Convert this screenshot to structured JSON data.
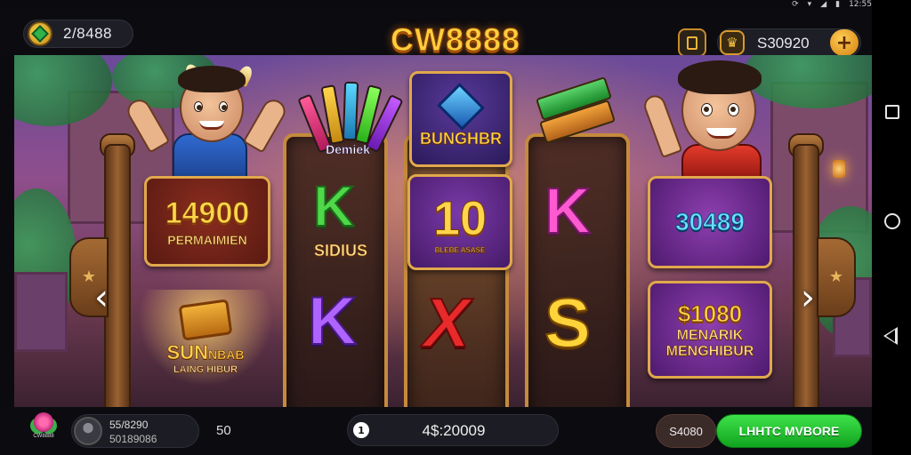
{
  "status_bar": {
    "time": "12:55"
  },
  "header": {
    "game_title": "CW8888",
    "left_balance": "2/8488",
    "right_balance": "S30920",
    "plus_label": "+"
  },
  "reels": {
    "left": {
      "tile_top_number": "14900",
      "tile_top_caption": "PERMAIMIEN",
      "tile_bottom_line1": "SUN",
      "tile_bottom_line2": "NBAB",
      "tile_bottom_caption": "LAING HIBUR"
    },
    "reel1": {
      "top_label": "Demiek",
      "mid_letter": "K",
      "mid_label": "SIDIUS",
      "bottom_letter": "K"
    },
    "reel2": {
      "top_label": "BUNGHBR",
      "mid_number": "10",
      "mid_caption": "BLEBE ASASE",
      "bottom_letter": "X"
    },
    "reel3": {
      "mid_letter": "K",
      "bottom_letter": "S"
    },
    "right": {
      "tile_top_number": "30489",
      "tile_bottom_number": "$1080",
      "tile_bottom_line1": "MENARIK",
      "tile_bottom_line2": "MENGHIBUR"
    }
  },
  "footer": {
    "mini_logo_caption": "CW8888",
    "account_line1": "55/8290",
    "account_line2": "50189086",
    "bet_value": "50",
    "win_icon": "1",
    "win_value": "4$:20009",
    "auto_label": "S4080",
    "spin_label": "LHHTC MVBORE"
  },
  "icons": {
    "status": [
      "sync-icon",
      "wifi-icon",
      "signal-icon",
      "battery-icon"
    ],
    "nav": [
      "recents-icon",
      "home-icon",
      "back-icon"
    ]
  },
  "colors": {
    "title_gold": "#ffcf3d",
    "spin_green": "#2fd23a",
    "frame_gold": "#c58a3c"
  }
}
